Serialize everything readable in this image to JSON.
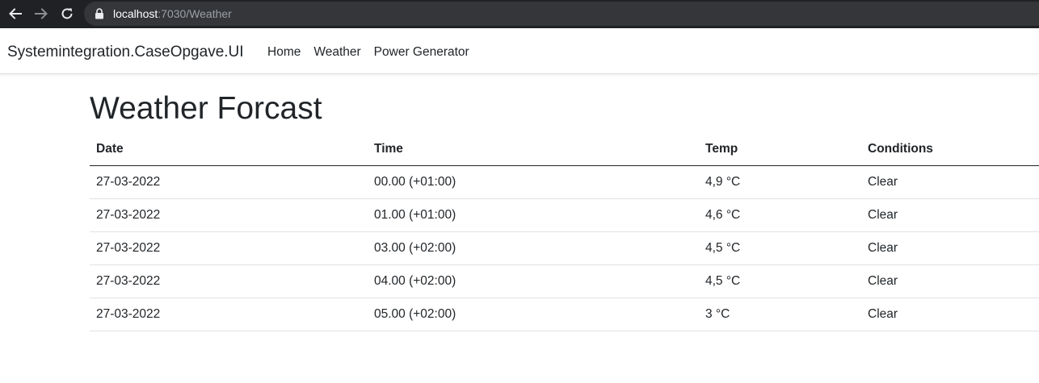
{
  "browser": {
    "url_host": "localhost",
    "url_rest": ":7030/Weather",
    "back_icon": "back-arrow-icon",
    "forward_icon": "forward-arrow-icon",
    "reload_icon": "reload-icon",
    "lock_icon": "lock-icon"
  },
  "navbar": {
    "brand": "Systemintegration.CaseOpgave.UI",
    "links": [
      {
        "label": "Home"
      },
      {
        "label": "Weather"
      },
      {
        "label": "Power Generator"
      }
    ]
  },
  "main": {
    "title": "Weather Forcast",
    "table": {
      "headers": [
        "Date",
        "Time",
        "Temp",
        "Conditions"
      ],
      "rows": [
        {
          "date": "27-03-2022",
          "time": "00.00 (+01:00)",
          "temp": "4,9 °C",
          "conditions": "Clear"
        },
        {
          "date": "27-03-2022",
          "time": "01.00 (+01:00)",
          "temp": "4,6 °C",
          "conditions": "Clear"
        },
        {
          "date": "27-03-2022",
          "time": "03.00 (+02:00)",
          "temp": "4,5 °C",
          "conditions": "Clear"
        },
        {
          "date": "27-03-2022",
          "time": "04.00 (+02:00)",
          "temp": "4,5 °C",
          "conditions": "Clear"
        },
        {
          "date": "27-03-2022",
          "time": "05.00 (+02:00)",
          "temp": "3 °C",
          "conditions": "Clear"
        }
      ]
    }
  },
  "colors": {
    "browser_bar": "#202124",
    "omnibox": "#35363a",
    "text": "#212529",
    "row_border": "#dee2e6"
  }
}
